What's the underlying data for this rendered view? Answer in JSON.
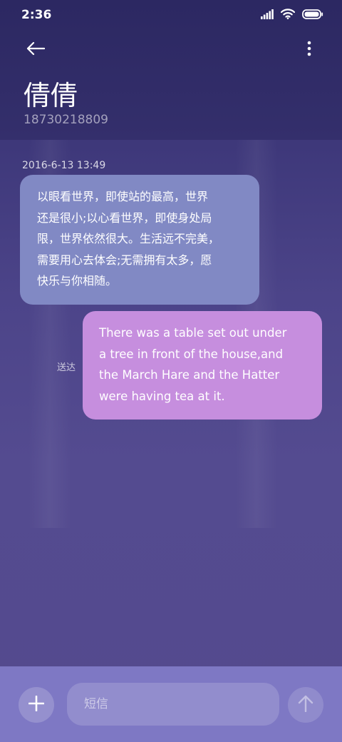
{
  "status_bar": {
    "time": "2:36",
    "icons": [
      "signal-icon",
      "wifi-icon",
      "battery-icon"
    ]
  },
  "header": {
    "back_icon": "arrow-left-icon",
    "more_icon": "more-vertical-icon",
    "contact_name": "倩倩",
    "contact_number": "18730218809"
  },
  "conversation": {
    "timestamp": "2016-6-13 13:49",
    "messages": [
      {
        "direction": "incoming",
        "lines": [
          "以眼看世界，即使站的最高，世界",
          "还是很小;以心看世界，即使身处局",
          "限，世界依然很大。生活远不完美，",
          "需要用心去体会;无需拥有太多，愿",
          "快乐与你相随。"
        ]
      },
      {
        "direction": "outgoing",
        "status": "送达",
        "lines": [
          "There was a table set out under",
          "a tree in front of the house,and",
          "the March Hare and the Hatter",
          "were having tea at it."
        ]
      }
    ]
  },
  "composer": {
    "add_icon": "plus-icon",
    "placeholder": "短信",
    "value": "",
    "send_icon": "arrow-up-icon"
  },
  "colors": {
    "incoming_bubble": "#8189c4",
    "outgoing_bubble": "#c68ede",
    "composer_bar": "#7e78c4",
    "header_bg": "#2c2862"
  }
}
